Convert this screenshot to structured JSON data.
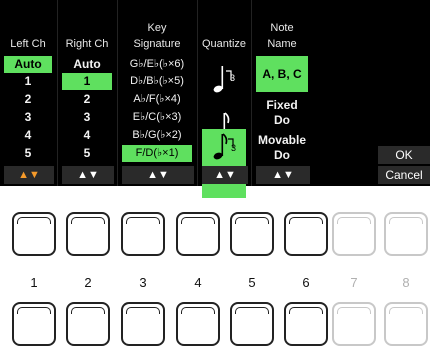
{
  "columns": {
    "left_ch": {
      "header": [
        "",
        "Left Ch"
      ],
      "items": [
        "Auto",
        "1",
        "2",
        "3",
        "4",
        "5"
      ],
      "footer": "▲▼"
    },
    "right_ch": {
      "header": [
        "",
        "Right Ch"
      ],
      "items": [
        "Auto",
        "1",
        "2",
        "3",
        "4",
        "5"
      ],
      "footer": "▲▼"
    },
    "key_sig": {
      "header": [
        "Key",
        "Signature"
      ],
      "items": [
        "G♭/E♭(♭×6)",
        "D♭/B♭(♭×5)",
        "A♭/F(♭×4)",
        "E♭/C(♭×3)",
        "B♭/G(♭×2)",
        "F/D(♭×1)"
      ],
      "footer": "▲▼"
    },
    "quantize": {
      "header": [
        "",
        "Quantize"
      ],
      "footer": "▲▼"
    },
    "note_name": {
      "header": [
        "Note",
        "Name"
      ],
      "items": [
        "A, B, C",
        "Fixed",
        "Do",
        "Movable",
        "Do"
      ],
      "footer": "▲▼"
    }
  },
  "buttons": {
    "ok": "OK",
    "cancel": "Cancel"
  },
  "panel_numbers": [
    "1",
    "2",
    "3",
    "4",
    "5",
    "6",
    "7",
    "8"
  ],
  "colors": {
    "selected": "#5fe05f",
    "active_arrow": "#f59a2a",
    "screen_bg": "#000000"
  }
}
